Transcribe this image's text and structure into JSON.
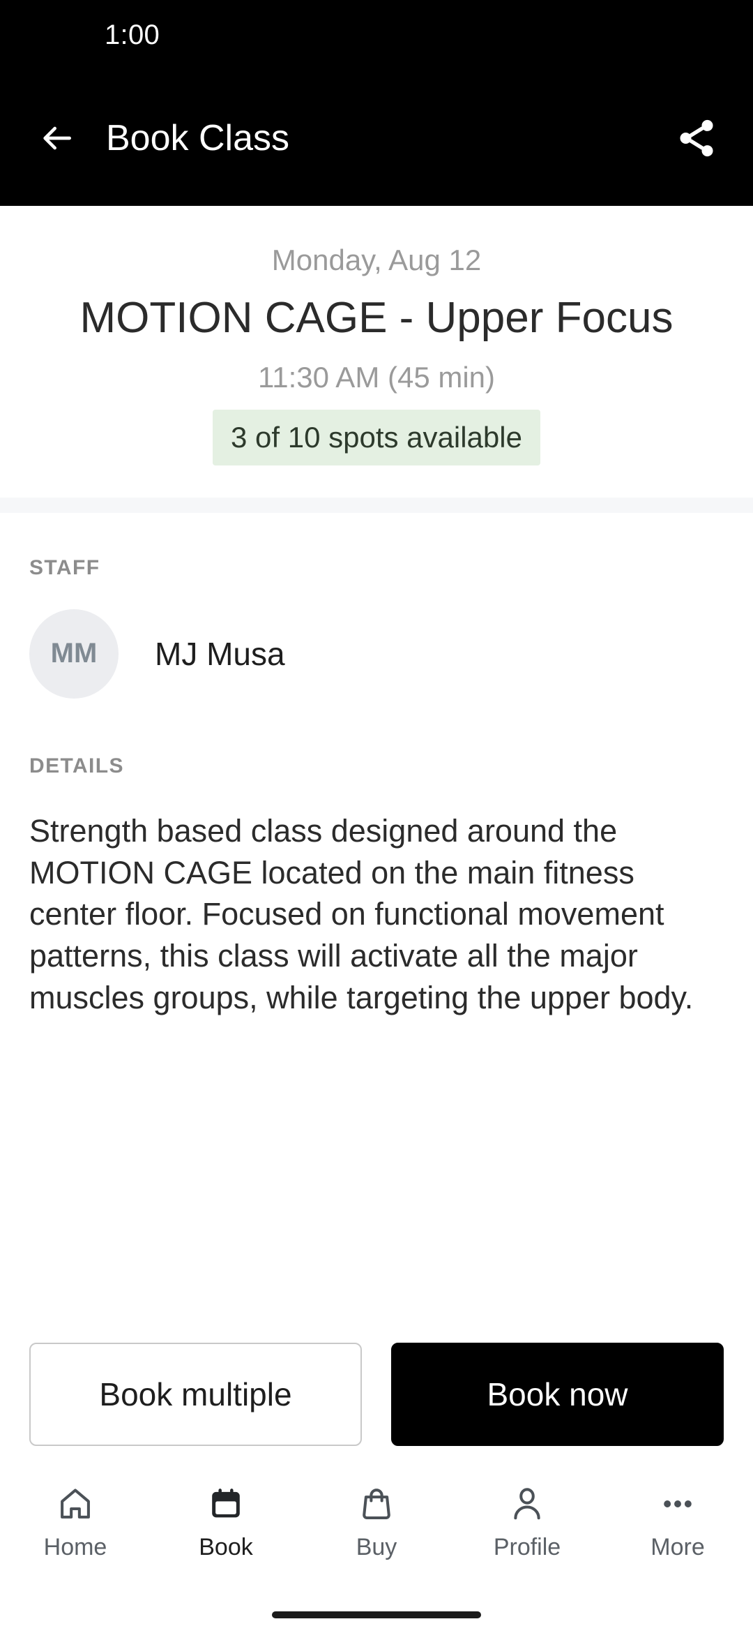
{
  "status_bar": {
    "time": "1:00"
  },
  "app_bar": {
    "title": "Book Class",
    "back_icon": "arrow-left-icon",
    "share_icon": "share-icon"
  },
  "hero": {
    "date": "Monday, Aug 12",
    "class_title": "MOTION CAGE - Upper Focus",
    "time_duration": "11:30 AM (45 min)",
    "spots_text": "3 of 10 spots available",
    "spots_bg_color": "#e4f0e2",
    "spots_text_color": "#2d3a2c"
  },
  "staff": {
    "label": "STAFF",
    "avatar_initials": "MM",
    "name": "MJ Musa"
  },
  "details": {
    "label": "DETAILS",
    "text": "Strength based class designed around the MOTION CAGE located on the main fitness center floor.  Focused on functional movement patterns, this class will activate all the major muscles groups, while targeting the upper body."
  },
  "actions": {
    "secondary_label": "Book multiple",
    "primary_label": "Book now",
    "primary_bg_color": "#000000"
  },
  "bottom_nav": {
    "items": [
      {
        "label": "Home",
        "icon": "home-icon",
        "active": false
      },
      {
        "label": "Book",
        "icon": "calendar-icon",
        "active": true
      },
      {
        "label": "Buy",
        "icon": "bag-icon",
        "active": false
      },
      {
        "label": "Profile",
        "icon": "person-icon",
        "active": false
      },
      {
        "label": "More",
        "icon": "ellipsis-icon",
        "active": false
      }
    ]
  }
}
